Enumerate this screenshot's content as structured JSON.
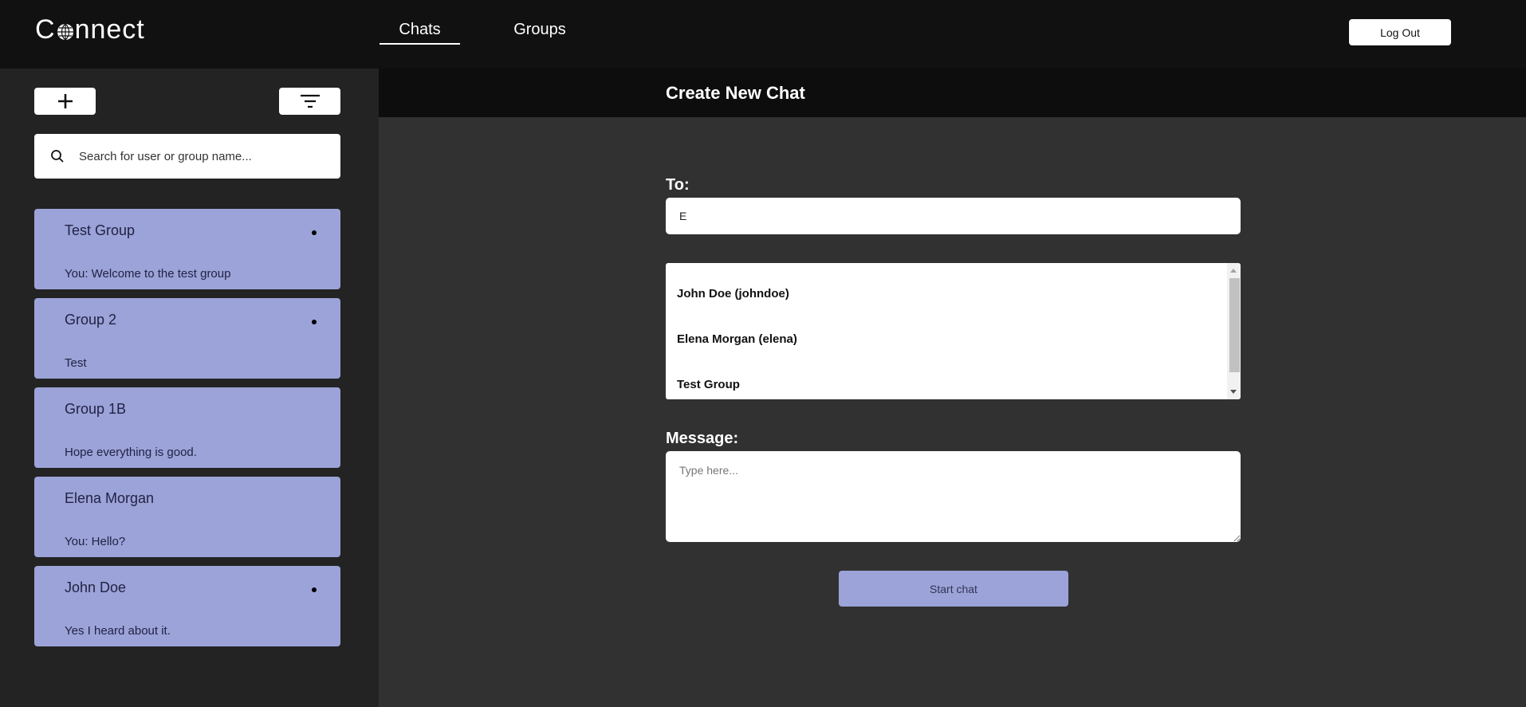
{
  "header": {
    "logo_text_prefix": "C",
    "logo_text_suffix": "nnect",
    "tabs": [
      {
        "label": "Chats",
        "active": true
      },
      {
        "label": "Groups",
        "active": false
      }
    ],
    "logout_label": "Log Out"
  },
  "sidebar": {
    "add_icon": "plus-icon",
    "filter_icon": "filter-icon",
    "search": {
      "placeholder": "Search for user or group name...",
      "icon": "search-icon"
    },
    "chats": [
      {
        "name": "Test Group",
        "preview": "You: Welcome to the test group",
        "unread": true
      },
      {
        "name": "Group 2",
        "preview": "Test",
        "unread": true
      },
      {
        "name": "Group 1B",
        "preview": "Hope everything is good.",
        "unread": false
      },
      {
        "name": "Elena Morgan",
        "preview": "You: Hello?",
        "unread": false
      },
      {
        "name": "John Doe",
        "preview": "Yes I heard about it.",
        "unread": true
      }
    ]
  },
  "main": {
    "title": "Create New Chat",
    "to_label": "To:",
    "to_value": "E",
    "results": [
      "John Doe (johndoe)",
      "Elena Morgan (elena)",
      "Test Group"
    ],
    "message_label": "Message:",
    "message_placeholder": "Type here...",
    "start_label": "Start chat"
  },
  "colors": {
    "accent": "#9ba3d8",
    "topbar": "#111111",
    "sidebar": "#232323",
    "main_bg": "#313131"
  }
}
